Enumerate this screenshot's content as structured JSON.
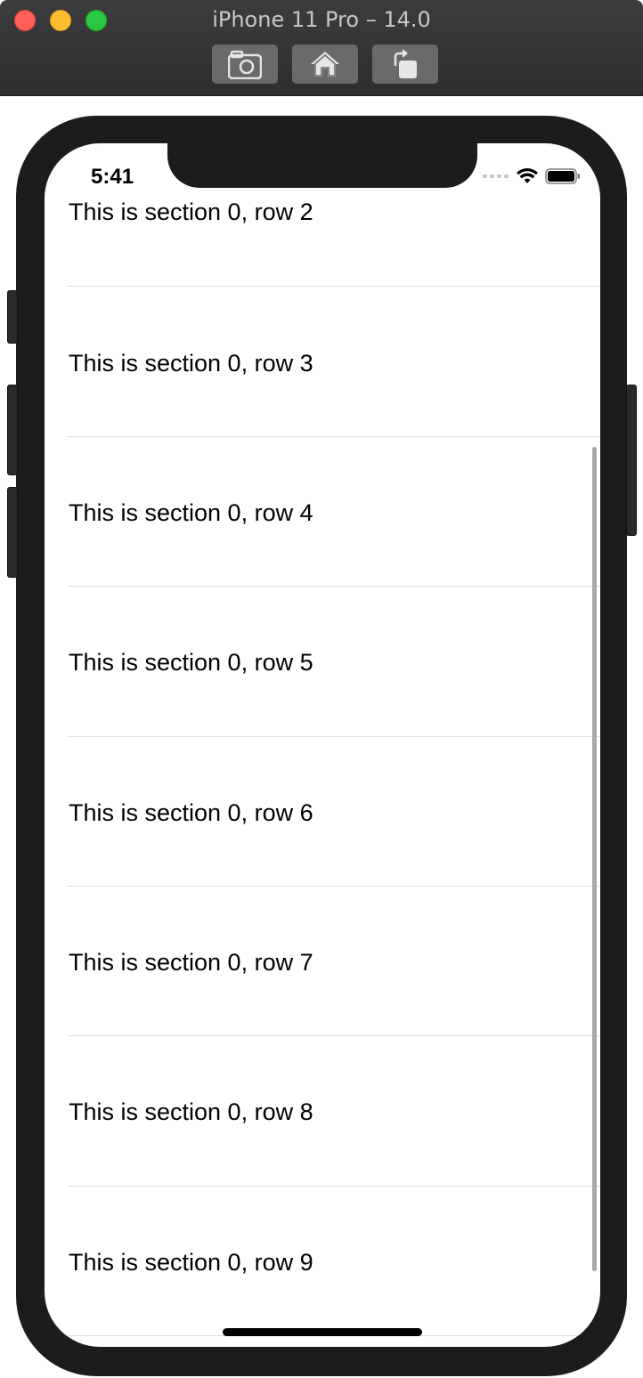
{
  "window": {
    "title": "iPhone 11 Pro – 14.0",
    "toolbar": {
      "screenshot_icon": "camera-icon",
      "home_icon": "home-icon",
      "rotate_icon": "rotate-icon"
    }
  },
  "status_bar": {
    "time": "5:41",
    "icons": [
      "cellular-icon",
      "wifi-icon",
      "battery-icon"
    ]
  },
  "table": {
    "rows": [
      {
        "label": "This is section 0, row 2"
      },
      {
        "label": "This is section 0, row 3"
      },
      {
        "label": "This is section 0, row 4"
      },
      {
        "label": "This is section 0, row 5"
      },
      {
        "label": "This is section 0, row 6"
      },
      {
        "label": "This is section 0, row 7"
      },
      {
        "label": "This is section 0, row 8"
      },
      {
        "label": "This is section 0, row 9"
      }
    ]
  },
  "colors": {
    "close": "#fe5f57",
    "minimize": "#febc2e",
    "maximize": "#28c840",
    "device_frame": "#1c1c1e",
    "separator": "#dcdcdc"
  }
}
